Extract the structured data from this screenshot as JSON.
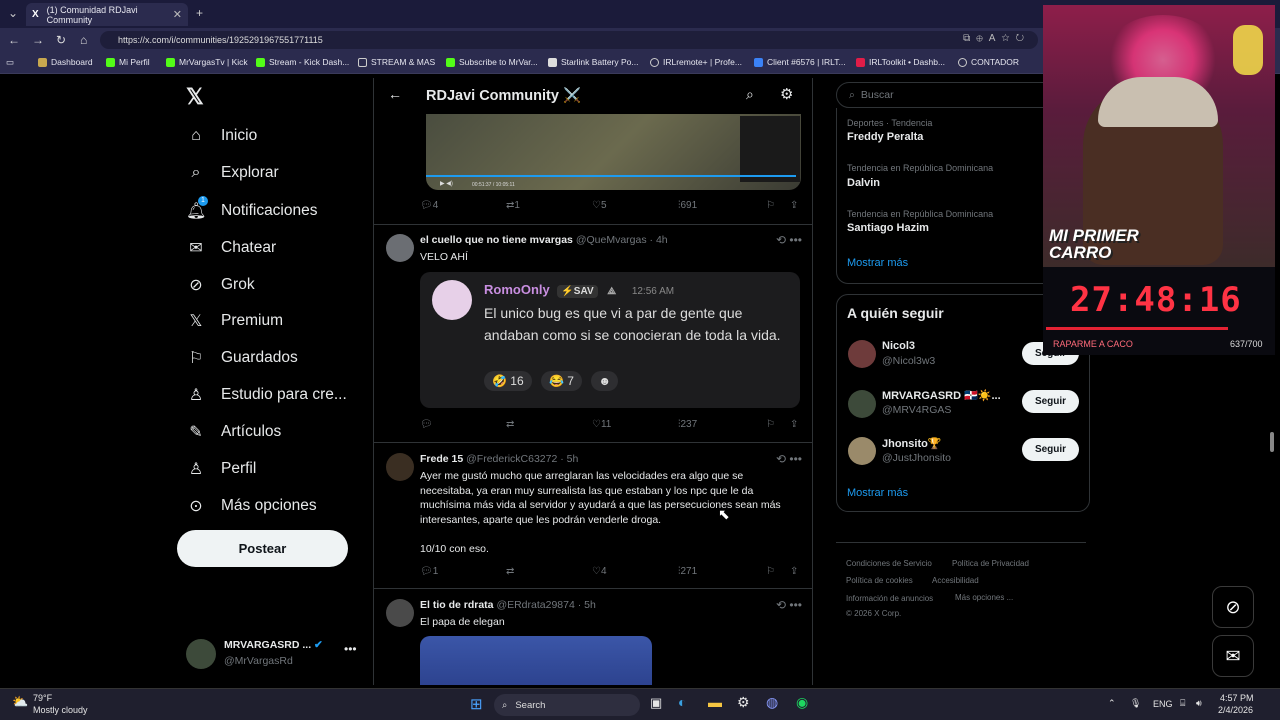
{
  "browser": {
    "tab_title": "(1) Comunidad RDJavi Community",
    "url": "https://x.com/i/communities/1925291967551771115",
    "bookmarks": [
      "Dashboard",
      "Mi Perfil",
      "MrVargasTv | Kick",
      "Stream - Kick Dash...",
      "STREAM & MAS",
      "Subscribe to MrVar...",
      "Starlink Battery Po...",
      "IRLremote+ | Profe...",
      "Client #6576 | IRLT...",
      "IRLToolkit • Dashb...",
      "CONTADOR"
    ]
  },
  "nav": {
    "items": [
      "Inicio",
      "Explorar",
      "Notificaciones",
      "Chatear",
      "Grok",
      "Premium",
      "Guardados",
      "Estudio para cre...",
      "Artículos",
      "Perfil",
      "Más opciones"
    ],
    "notif_badge": "1",
    "post_label": "Postear",
    "account_name": "MRVARGASRD ...",
    "account_handle": "@MrVargasRd"
  },
  "main": {
    "title": "RDJavi Community ⚔️",
    "video_time": "00:51:37 / 10:05:11",
    "tweet0_actions": {
      "replies": "4",
      "retweets": "1",
      "likes": "5",
      "views": "691"
    },
    "tweets": [
      {
        "name": "el cuello que no tiene mvargas",
        "handle": "@QueMvargas",
        "time": "4h",
        "text": "VELO AHÍ",
        "quote": {
          "name": "RomoOnly",
          "tag": "⚡SAV",
          "time": "12:56 AM",
          "text": "El unico bug es que vi a par de gente que andaban como si se conocieran de toda la vida.",
          "react1": "16",
          "react2": "7"
        },
        "replies": "",
        "retweets": "",
        "likes": "11",
        "views": "237"
      },
      {
        "name": "Frede 15",
        "handle": "@FrederickC63272",
        "time": "5h",
        "text": "Ayer me gustó mucho que arreglaran las velocidades era algo que se necesitaba, ya eran muy surrealista las que estaban y los npc que le da muchísima más vida al servidor y ayudará a que las persecuciones sean más interesantes, aparte que les podrán venderle droga.",
        "text2": "10/10 con eso.",
        "replies": "1",
        "retweets": "",
        "likes": "4",
        "views": "271"
      },
      {
        "name": "El tio de rdrata",
        "handle": "@ERdrata29874",
        "time": "5h",
        "text": "El papa de elegan"
      }
    ]
  },
  "right": {
    "search_placeholder": "Buscar",
    "trends": [
      {
        "category": "Deportes · Tendencia",
        "name": "Freddy Peralta"
      },
      {
        "category": "Tendencia en República Dominicana",
        "name": "Dalvin"
      },
      {
        "category": "Tendencia en República Dominicana",
        "name": "Santiago Hazim"
      }
    ],
    "show_more": "Mostrar más",
    "follow_title": "A quién seguir",
    "follow": [
      {
        "name": "Nicol3",
        "handle": "@Nicol3w3"
      },
      {
        "name": "MRVARGASRD 🇩🇴☀️...",
        "handle": "@MRV4RGAS"
      },
      {
        "name": "Jhonsito🏆",
        "handle": "@JustJhonsito"
      }
    ],
    "follow_btn": "Seguir",
    "footer": [
      "Condiciones de Servicio",
      "Política de Privacidad",
      "Política de cookies",
      "Accesibilidad",
      "Información de anuncios",
      "Más opciones ...",
      "© 2026 X Corp."
    ]
  },
  "overlay": {
    "banner": "MI PRIMER CARRO",
    "timer": "27:48:16",
    "timer_label": "RAPARME A CACO",
    "timer_count": "637/700",
    "timer_progress": 0.91
  },
  "taskbar": {
    "weather_temp": "79°F",
    "weather_desc": "Mostly cloudy",
    "search": "Search",
    "lang": "ENG",
    "time": "4:57 PM",
    "date": "2/4/2026"
  }
}
